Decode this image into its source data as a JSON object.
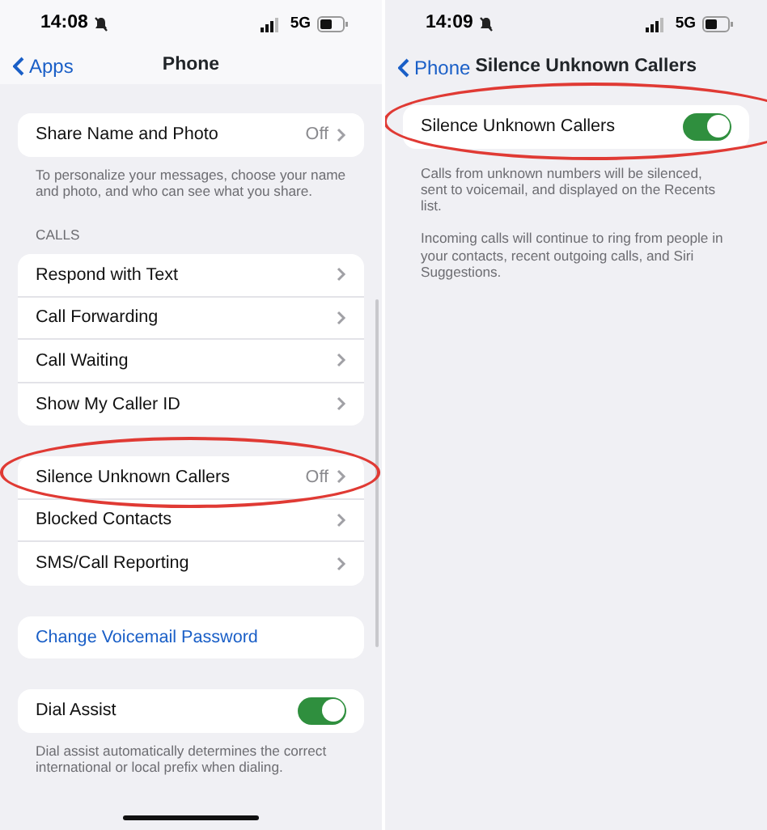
{
  "screens": [
    {
      "status_bar": {
        "time": "14:08",
        "network": "5G"
      },
      "nav": {
        "back": "Apps",
        "title": "Phone"
      },
      "sections": [
        {
          "rows": [
            {
              "kind": "link",
              "label": "Share Name and Photo",
              "value": "Off",
              "circled": false
            }
          ],
          "footer": "To personalize your messages, choose your name and photo, and who can see what you share."
        },
        {
          "header": "CALLS",
          "rows": [
            {
              "kind": "link",
              "label": "Respond with Text",
              "circled": false
            },
            {
              "kind": "link",
              "label": "Call Forwarding",
              "circled": false
            },
            {
              "kind": "link",
              "label": "Call Waiting",
              "circled": false
            },
            {
              "kind": "link",
              "label": "Show My Caller ID",
              "circled": false
            }
          ]
        },
        {
          "rows": [
            {
              "kind": "link",
              "label": "Silence Unknown Callers",
              "value": "Off",
              "circled": true
            },
            {
              "kind": "link",
              "label": "Blocked Contacts",
              "circled": false
            },
            {
              "kind": "link",
              "label": "SMS/Call Reporting",
              "circled": false
            }
          ]
        },
        {
          "rows": [
            {
              "kind": "action",
              "label": "Change Voicemail Password",
              "circled": false
            }
          ]
        },
        {
          "rows": [
            {
              "kind": "toggle",
              "label": "Dial Assist",
              "on": true,
              "circled": false
            }
          ],
          "footer": "Dial assist automatically determines the correct international or local prefix when dialing."
        }
      ]
    },
    {
      "status_bar": {
        "time": "14:09",
        "network": "5G"
      },
      "nav": {
        "back": "Phone",
        "title": "Silence Unknown Callers"
      },
      "sections": [
        {
          "rows": [
            {
              "kind": "toggle",
              "label": "Silence Unknown Callers",
              "on": true,
              "circled": true
            }
          ],
          "footer": "Calls from unknown numbers will be silenced, sent to voicemail, and displayed on the Recents list.",
          "footer_2": "Incoming calls will continue to ring from people in your contacts, recent outgoing calls, and Siri Suggestions."
        }
      ]
    }
  ]
}
